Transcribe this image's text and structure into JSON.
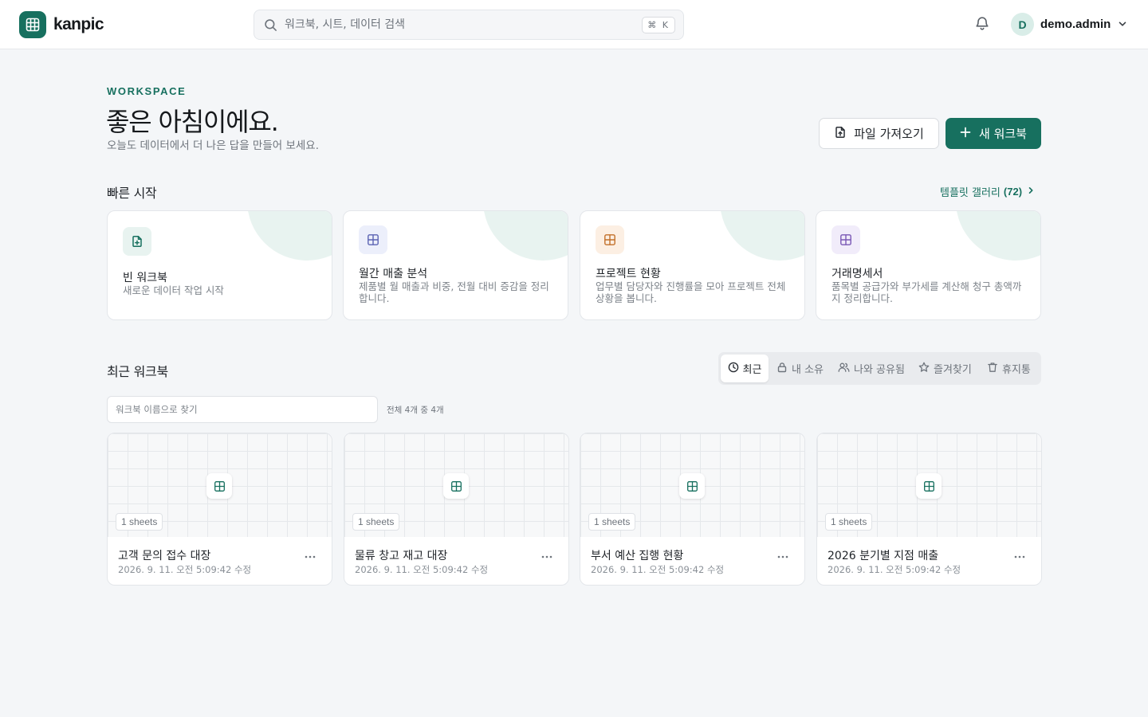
{
  "header": {
    "brand": "kanpic",
    "search_placeholder": "워크북, 시트, 데이터 검색",
    "search_shortcut": "⌘ K",
    "user": {
      "initial": "D",
      "name": "demo.admin"
    }
  },
  "hero": {
    "eyebrow": "WORKSPACE",
    "title": "좋은 아침이에요.",
    "subtitle": "오늘도 데이터에서 더 나은 답을 만들어 보세요.",
    "import_label": "파일 가져오기",
    "new_label": "새 워크북"
  },
  "quick_start": {
    "title": "빠른 시작",
    "gallery_label": "템플릿 갤러리",
    "gallery_count": "(72)",
    "cards": [
      {
        "title": "빈 워크북",
        "desc": "새로운 데이터 작업 시작",
        "icon": "file-plus-icon",
        "accent": "#17705f",
        "tint": "#e8f3f0"
      },
      {
        "title": "월간 매출 분석",
        "desc": "제품별 월 매출과 비중, 전월 대비 증감을 정리합니다.",
        "icon": "grid-icon",
        "accent": "#5b63b3",
        "tint": "#eceffb"
      },
      {
        "title": "프로젝트 현황",
        "desc": "업무별 담당자와 진행률을 모아 프로젝트 전체 상황을 봅니다.",
        "icon": "grid-icon",
        "accent": "#c2702a",
        "tint": "#fcefe3"
      },
      {
        "title": "거래명세서",
        "desc": "품목별 공급가와 부가세를 계산해 청구 총액까지 정리합니다.",
        "icon": "grid-icon",
        "accent": "#7a58b5",
        "tint": "#f1ecfa"
      }
    ]
  },
  "recent": {
    "title": "최근 워크북",
    "tabs": [
      {
        "label": "최근",
        "icon": "clock-icon",
        "active": true
      },
      {
        "label": "내 소유",
        "icon": "lock-icon",
        "active": false
      },
      {
        "label": "나와 공유됨",
        "icon": "users-icon",
        "active": false
      },
      {
        "label": "즐겨찾기",
        "icon": "star-icon",
        "active": false
      },
      {
        "label": "휴지통",
        "icon": "trash-icon",
        "active": false
      }
    ],
    "filter_placeholder": "워크북 이름으로 찾기",
    "count_label": "전체 4개 중 4개",
    "workbooks": [
      {
        "title": "고객 문의 접수 대장",
        "sheets": "1 sheets",
        "modified": "2026. 9. 11. 오전 5:09:42 수정"
      },
      {
        "title": "물류 창고 재고 대장",
        "sheets": "1 sheets",
        "modified": "2026. 9. 11. 오전 5:09:42 수정"
      },
      {
        "title": "부서 예산 집행 현황",
        "sheets": "1 sheets",
        "modified": "2026. 9. 11. 오전 5:09:42 수정"
      },
      {
        "title": "2026 분기별 지점 매출",
        "sheets": "1 sheets",
        "modified": "2026. 9. 11. 오전 5:09:42 수정"
      }
    ]
  },
  "colors": {
    "brand": "#17705f",
    "background": "#f4f6f8"
  }
}
